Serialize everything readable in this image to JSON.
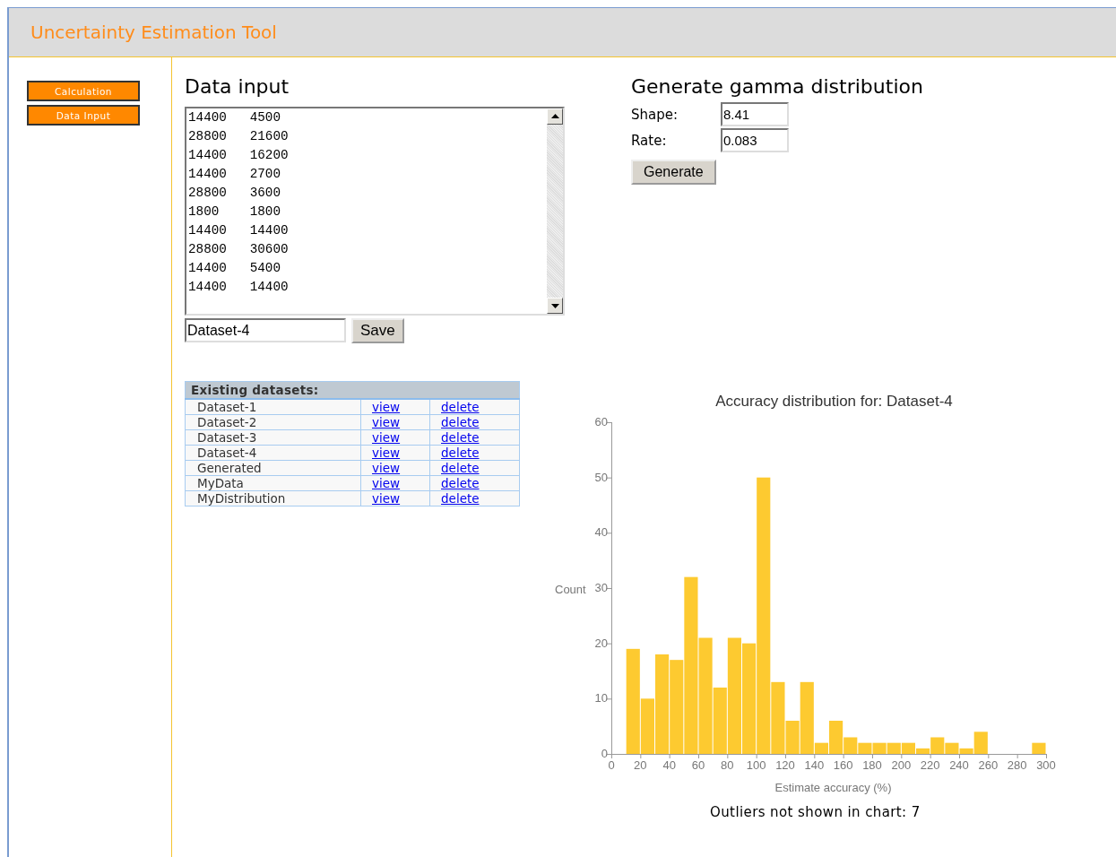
{
  "header": {
    "title": "Uncertainty Estimation Tool"
  },
  "sidebar": {
    "items": [
      {
        "label": "Calculation"
      },
      {
        "label": "Data Input"
      }
    ]
  },
  "data_input": {
    "title": "Data input",
    "rows": [
      [
        "14400",
        "4500"
      ],
      [
        "28800",
        "21600"
      ],
      [
        "14400",
        "16200"
      ],
      [
        "14400",
        "2700"
      ],
      [
        "28800",
        "3600"
      ],
      [
        "1800",
        "1800"
      ],
      [
        "14400",
        "14400"
      ],
      [
        "28800",
        "30600"
      ],
      [
        "14400",
        "5400"
      ],
      [
        "14400",
        "14400"
      ]
    ],
    "name_value": "Dataset-4",
    "save_button": "Save"
  },
  "datasets": {
    "title": "Existing datasets:",
    "rows": [
      {
        "name": "Dataset-1",
        "view": "view",
        "delete": "delete"
      },
      {
        "name": "Dataset-2",
        "view": "view",
        "delete": "delete"
      },
      {
        "name": "Dataset-3",
        "view": "view",
        "delete": "delete"
      },
      {
        "name": "Dataset-4",
        "view": "view",
        "delete": "delete"
      },
      {
        "name": "Generated",
        "view": "view",
        "delete": "delete"
      },
      {
        "name": "MyData",
        "view": "view",
        "delete": "delete"
      },
      {
        "name": "MyDistribution",
        "view": "view",
        "delete": "delete"
      }
    ]
  },
  "gamma": {
    "title": "Generate gamma distribution",
    "fields": [
      {
        "label": "Shape:",
        "value": "8.41"
      },
      {
        "label": "Rate:",
        "value": "0.083"
      }
    ],
    "button": "Generate"
  },
  "chart": {
    "chart_data": {
      "type": "bar",
      "title": "Accuracy distribution for: Dataset-4",
      "xlabel": "Estimate accuracy (%)",
      "ylabel": "Count",
      "x": [
        15,
        25,
        35,
        45,
        55,
        65,
        75,
        85,
        95,
        105,
        115,
        125,
        135,
        145,
        155,
        165,
        175,
        185,
        195,
        205,
        215,
        225,
        235,
        245,
        255,
        265,
        275,
        285,
        295
      ],
      "values": [
        19,
        10,
        18,
        17,
        32,
        21,
        12,
        21,
        20,
        50,
        13,
        6,
        13,
        2,
        6,
        3,
        2,
        2,
        2,
        2,
        1,
        3,
        2,
        1,
        4,
        0,
        0,
        0,
        2
      ],
      "xlim": [
        0,
        300
      ],
      "ylim": [
        0,
        60
      ],
      "xticks": [
        0,
        20,
        40,
        60,
        80,
        100,
        120,
        140,
        160,
        180,
        200,
        220,
        240,
        260,
        280,
        300
      ],
      "yticks": [
        0,
        10,
        20,
        30,
        40,
        50,
        60
      ]
    },
    "note": "Outliers not shown in chart: 7"
  }
}
